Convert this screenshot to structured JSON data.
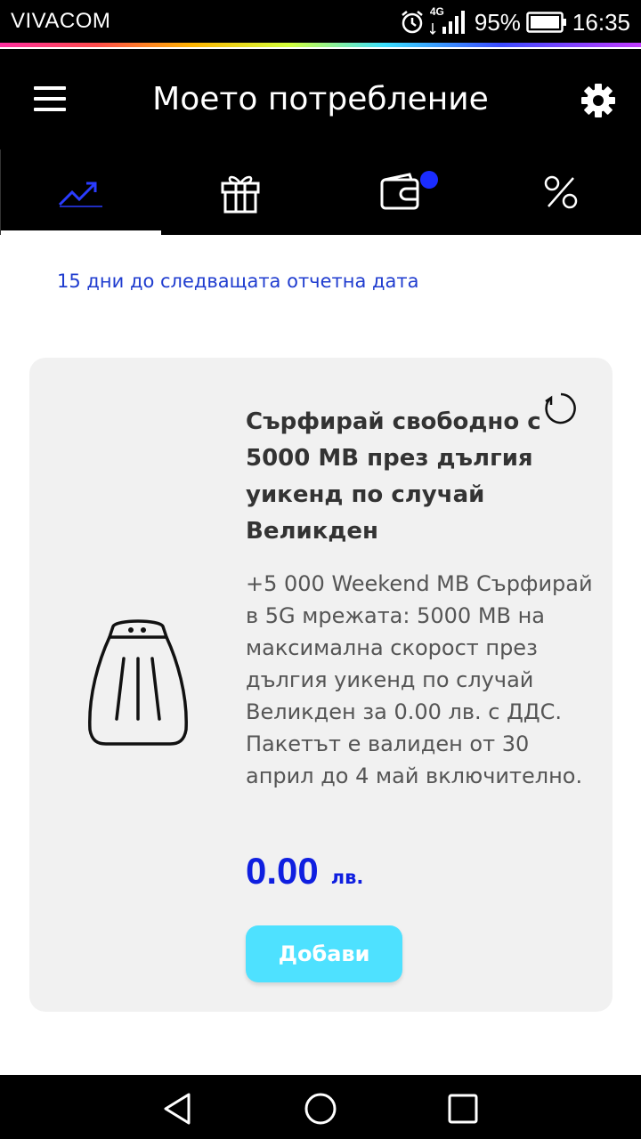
{
  "status_bar": {
    "carrier": "VIVACOM",
    "network": "4G",
    "battery": "95%",
    "time": "16:35"
  },
  "header": {
    "title": "Моето потребление"
  },
  "tabs": [
    {
      "name": "usage",
      "icon": "trending-up-icon",
      "active": true
    },
    {
      "name": "gifts",
      "icon": "gift-icon",
      "active": false
    },
    {
      "name": "wallet",
      "icon": "wallet-icon",
      "active": false,
      "has_badge": true
    },
    {
      "name": "discounts",
      "icon": "percent-icon",
      "active": false
    }
  ],
  "billing_note": "15 дни до следващата отчетна дата",
  "offer": {
    "title": "Сърфирай свободно с 5000 MB през дългия уикенд по случай Великден",
    "description": "+5 000 Weekend MB Сърфирай в 5G мрежата: 5000 MB на максимална скорост през дългия уикенд по случай Великден за 0.00 лв. с ДДС. Пакетът е валиден от 30 април до 4 май включително.",
    "price": "0.00",
    "currency": "лв.",
    "add_label": "Добави"
  },
  "colors": {
    "accent_blue": "#0f1fe0",
    "link_blue": "#1f3ccf",
    "button_cyan": "#4ee1ff",
    "badge_blue": "#1a2cff",
    "card_bg": "#f1f1f1"
  }
}
